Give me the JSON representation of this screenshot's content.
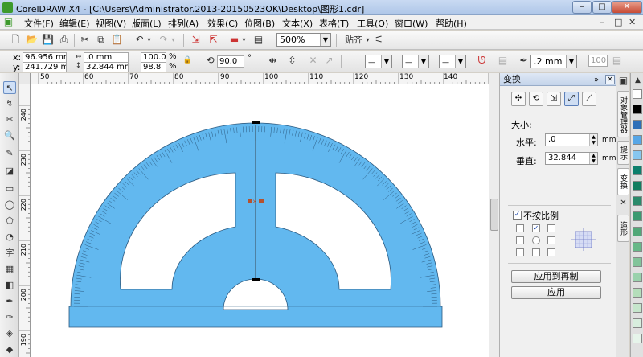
{
  "titlebar": {
    "title": "CorelDRAW X4 - [C:\\Users\\Administrator.2013-20150523OK\\Desktop\\图形1.cdr]",
    "minimize": "–",
    "maximize": "□",
    "close": "✕"
  },
  "menubar": {
    "items": [
      "文件(F)",
      "编辑(E)",
      "视图(V)",
      "版面(L)",
      "排列(A)",
      "效果(C)",
      "位图(B)",
      "文本(X)",
      "表格(T)",
      "工具(O)",
      "窗口(W)",
      "帮助(H)"
    ],
    "doc_controls": [
      "–",
      "□",
      "✕"
    ]
  },
  "toolbar": {
    "zoom": "500%",
    "snap_label": "贴齐"
  },
  "propbar": {
    "x_label": "x:",
    "x_value": "96.956 mm",
    "y_label": "y:",
    "y_value": "241.729 mm",
    "width_value": ".0 mm",
    "height_value": "32.844 mm",
    "scale_x": "100.0",
    "scale_y": "98.8",
    "percent": "%",
    "rotation": "90.0",
    "degree": "°",
    "outline_width": ".2 mm",
    "preset_value": "100"
  },
  "ruler": {
    "top_labels": [
      "50",
      "60",
      "70",
      "80",
      "90",
      "100",
      "110",
      "120",
      "130",
      "140"
    ],
    "left_labels": [
      "240",
      "230",
      "220",
      "210",
      "200",
      "190"
    ]
  },
  "docker": {
    "title": "变换",
    "size_heading": "大小:",
    "horizontal_label": "水平:",
    "horizontal_value": ".0",
    "vertical_label": "垂直:",
    "vertical_value": "32.844",
    "unit": "mm",
    "nonproportional_label": "不按比例",
    "apply_to_duplicate": "应用到再制",
    "apply": "应用"
  },
  "side_tabs": [
    "对象管理器",
    "提示",
    "变换",
    "造形"
  ],
  "colors": {
    "protractor_fill": "#62b8ef",
    "protractor_stroke": "#2c5a80",
    "canvas_bg": "#ffffff",
    "app_bg": "#d4d0c8",
    "selection_handle": "#000000",
    "center_marker": "#b5522f"
  },
  "palette": [
    "#ffffff",
    "#000000",
    "#2e6fb8",
    "#56a6e6",
    "#87c6ef",
    "#0c7f6c",
    "#127e60",
    "#2a8a6a",
    "#3a9a70",
    "#52a878",
    "#68b888",
    "#82c49a",
    "#9ad2ac",
    "#b4deba",
    "#c6e6cc",
    "#d8eede",
    "#e6f4ea"
  ]
}
